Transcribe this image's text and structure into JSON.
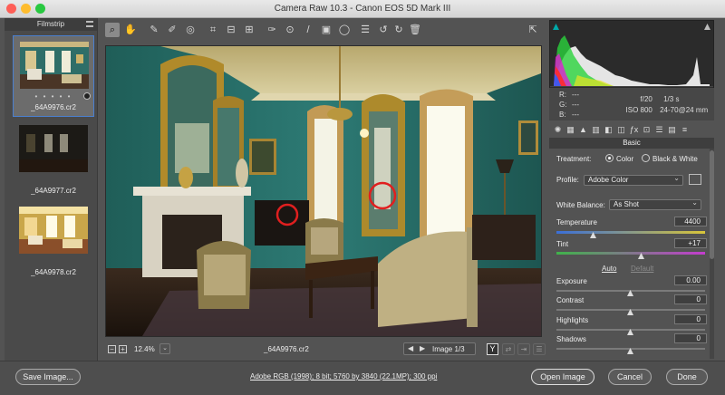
{
  "window": {
    "title": "Camera Raw 10.3  -  Canon EOS 5D Mark III",
    "colors": {
      "close": "#fe5f57",
      "minimize": "#febc2e",
      "zoom": "#28c840"
    }
  },
  "filmstrip": {
    "header": "Filmstrip",
    "items": [
      {
        "name": "_64A9976.cr2",
        "rating": "• • • • •",
        "selected": true
      },
      {
        "name": "_64A9977.cr2",
        "selected": false
      },
      {
        "name": "_64A9978.cr2",
        "selected": false
      }
    ]
  },
  "toolbar": {
    "tools": [
      "zoom-tool",
      "hand-tool",
      "white-balance-tool",
      "color-sampler-tool",
      "targeted-adjustment-tool",
      "crop-tool",
      "straighten-tool",
      "transform-tool",
      "spot-removal-tool",
      "red-eye-tool",
      "adjustment-brush",
      "graduated-filter",
      "radial-filter",
      "preferences",
      "rotate-left",
      "rotate-right",
      "trash"
    ]
  },
  "bottom": {
    "zoom": "12.4%",
    "filename": "_64A9976.cr2",
    "image_nav": "Image 1/3",
    "before_after": "Y"
  },
  "readout": {
    "r": "R:",
    "g": "G:",
    "b": "B:",
    "r_val": "---",
    "g_val": "---",
    "b_val": "---",
    "aperture": "f/20",
    "shutter": "1/3 s",
    "iso": "ISO 800",
    "lens": "24-70@24 mm"
  },
  "panel": {
    "title": "Basic",
    "treatment_label": "Treatment:",
    "treatment_color": "Color",
    "treatment_bw": "Black & White",
    "profile_label": "Profile:",
    "profile_value": "Adobe Color",
    "wb_label": "White Balance:",
    "wb_value": "As Shot",
    "temperature": {
      "label": "Temperature",
      "value": "4400",
      "position": 0.25
    },
    "tint": {
      "label": "Tint",
      "value": "+17",
      "position": 0.58
    },
    "auto": "Auto",
    "default": "Default",
    "exposure": {
      "label": "Exposure",
      "value": "0.00",
      "position": 0.5
    },
    "contrast": {
      "label": "Contrast",
      "value": "0",
      "position": 0.5
    },
    "highlights": {
      "label": "Highlights",
      "value": "0",
      "position": 0.5
    },
    "shadows": {
      "label": "Shadows",
      "value": "0",
      "position": 0.5
    }
  },
  "footer": {
    "save": "Save Image...",
    "workflow": "Adobe RGB (1998); 8 bit; 5760 by 3840 (22.1MP); 300 ppi",
    "open": "Open Image",
    "cancel": "Cancel",
    "done": "Done"
  }
}
